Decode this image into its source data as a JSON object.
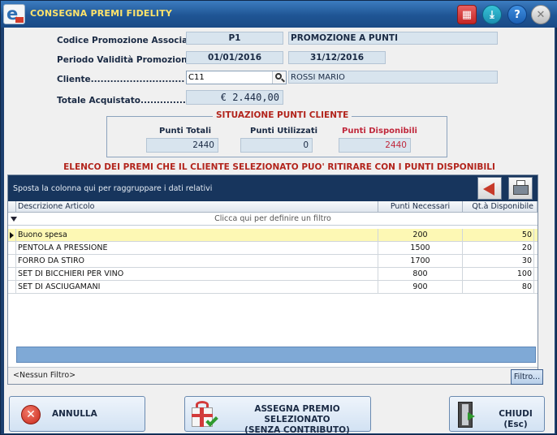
{
  "window": {
    "title": "CONSEGNA PREMI FIDELITY"
  },
  "form": {
    "promo_label": "Codice Promozione Associata.....",
    "promo_code": "P1",
    "promo_name": "PROMOZIONE A PUNTI",
    "period_label": "Periodo Validità Promozione......",
    "period_from": "01/01/2016",
    "period_to": "31/12/2016",
    "client_label": "Cliente.............................",
    "client_code": "C11",
    "client_name": "ROSSI MARIO",
    "total_label": "Totale Acquistato...................",
    "total_value": "€ 2.440,00"
  },
  "points": {
    "title": "SITUAZIONE PUNTI CLIENTE",
    "total_label": "Punti Totali",
    "total_value": "2440",
    "used_label": "Punti Utilizzati",
    "used_value": "0",
    "available_label": "Punti Disponibili",
    "available_value": "2440",
    "available_color": "#c0283c"
  },
  "list": {
    "title": "ELENCO DEI PREMI CHE IL CLIENTE SELEZIONATO PUO' RITIRARE CON I PUNTI DISPONIBILI",
    "group_hint": "Sposta la colonna qui per raggruppare i dati relativi",
    "filter_hint": "Clicca qui per definire un filtro",
    "columns": [
      "Descrizione Articolo",
      "Punti Necessari",
      "Qt.à Disponibile"
    ],
    "rows": [
      {
        "desc": "Buono spesa",
        "points": "200",
        "qty": "50"
      },
      {
        "desc": "PENTOLA A PRESSIONE",
        "points": "1500",
        "qty": "20"
      },
      {
        "desc": "FORRO DA STIRO",
        "points": "1700",
        "qty": "30"
      },
      {
        "desc": "SET DI BICCHIERI PER VINO",
        "points": "800",
        "qty": "100"
      },
      {
        "desc": "SET DI ASCIUGAMANI",
        "points": "900",
        "qty": "80"
      }
    ],
    "no_filter": "<Nessun Filtro>",
    "filter_button": "Filtro..."
  },
  "buttons": {
    "cancel": "ANNULLA",
    "assign_line1": "ASSEGNA PREMIO SELEZIONATO",
    "assign_line2": "(SENZA CONTRIBUTO)",
    "close": "CHIUDI (Esc)"
  },
  "icons": {
    "toolbar": [
      "calculator-icon",
      "download-icon",
      "help-icon",
      "close-icon"
    ]
  }
}
